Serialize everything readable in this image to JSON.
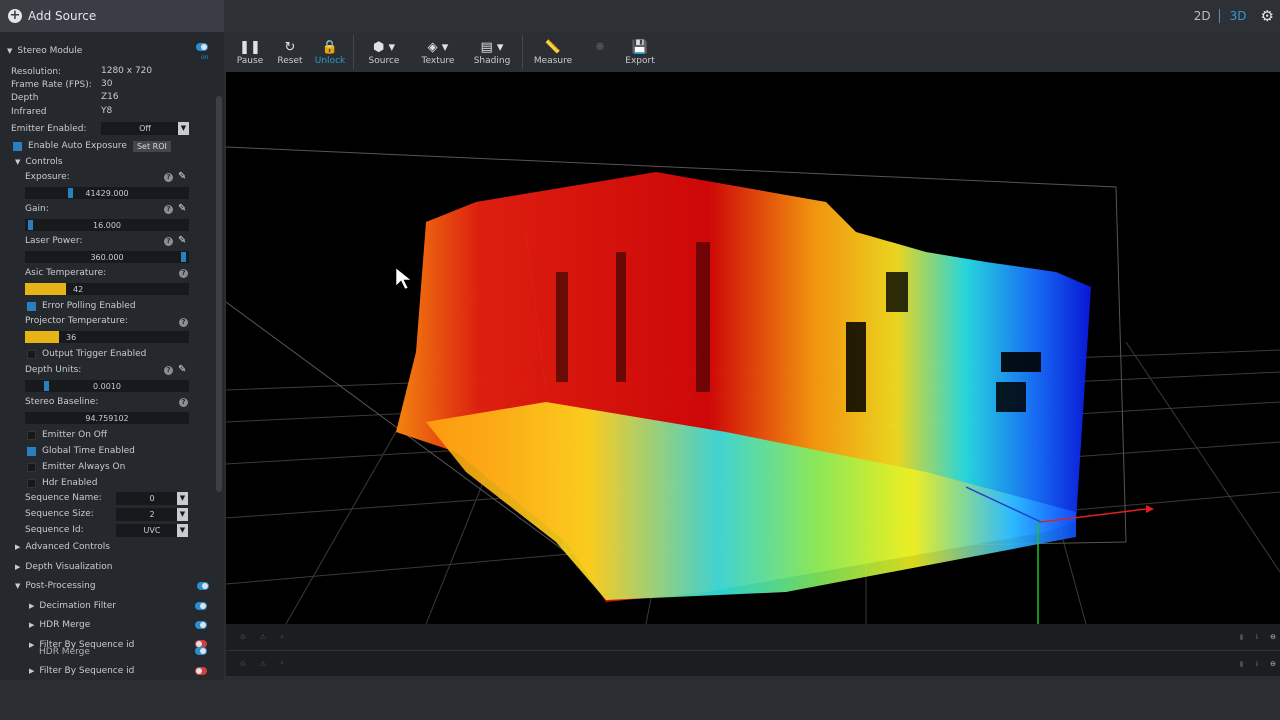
{
  "topbar": {
    "add_source_label": "Add Source",
    "view_2d": "2D",
    "view_3d": "3D"
  },
  "sidebar": {
    "module_title": "Stereo Module",
    "module_toggle_label": "on",
    "info": [
      {
        "label": "Resolution:",
        "value": "1280 x 720"
      },
      {
        "label": "Frame Rate (FPS):",
        "value": "30"
      },
      {
        "label": "Depth",
        "value": "Z16"
      },
      {
        "label": "Infrared",
        "value": "Y8"
      }
    ],
    "emitter_enabled": {
      "label": "Emitter Enabled:",
      "value": "Off"
    },
    "auto_exposure": {
      "label": "Enable Auto Exposure",
      "checked": true,
      "roi_button": "Set ROI"
    },
    "controls_title": "Controls",
    "exposure": {
      "label": "Exposure:",
      "value": "41429.000",
      "level": 0.27
    },
    "gain": {
      "label": "Gain:",
      "value": "16.000",
      "level": 0.02
    },
    "laser_power": {
      "label": "Laser Power:",
      "value": "360.000",
      "level": 0.98
    },
    "asic_temperature": {
      "label": "Asic Temperature:",
      "value": "42",
      "level": 0.25
    },
    "error_polling": {
      "label": "Error Polling Enabled",
      "checked": true
    },
    "projector_temperature": {
      "label": "Projector Temperature:",
      "value": "36",
      "level": 0.21
    },
    "output_trigger": {
      "label": "Output Trigger Enabled",
      "checked": false
    },
    "depth_units": {
      "label": "Depth Units:",
      "value": "0.0010",
      "level": 0.12
    },
    "stereo_baseline": {
      "label": "Stereo Baseline:",
      "value": "94.759102"
    },
    "emitter_on_off": {
      "label": "Emitter On Off",
      "checked": false
    },
    "global_time": {
      "label": "Global Time Enabled",
      "checked": true
    },
    "emitter_always_on": {
      "label": "Emitter Always On",
      "checked": false
    },
    "hdr_enabled": {
      "label": "Hdr Enabled",
      "checked": false
    },
    "sequence_name": {
      "label": "Sequence Name:",
      "value": "0"
    },
    "sequence_size": {
      "label": "Sequence Size:",
      "value": "2"
    },
    "sequence_id": {
      "label": "Sequence Id:",
      "value": "UVC"
    },
    "advanced_controls": "Advanced Controls",
    "depth_visualization": "Depth Visualization",
    "post_processing": "Post-Processing",
    "filters": [
      {
        "label": "Decimation Filter"
      },
      {
        "label": "HDR Merge"
      },
      {
        "label": "Filter By Sequence id"
      },
      {
        "label": "HDR Merge"
      },
      {
        "label": "Filter By Sequence id"
      }
    ]
  },
  "toolbar": {
    "pause": "Pause",
    "reset": "Reset",
    "unlock": "Unlock",
    "source": "Source",
    "texture": "Texture",
    "shading": "Shading",
    "measure": "Measure",
    "export": "Export"
  },
  "colors": {
    "accent": "#2e9ad0",
    "temperature_fill": "#e6b416",
    "toggle_off": "#d04040"
  }
}
